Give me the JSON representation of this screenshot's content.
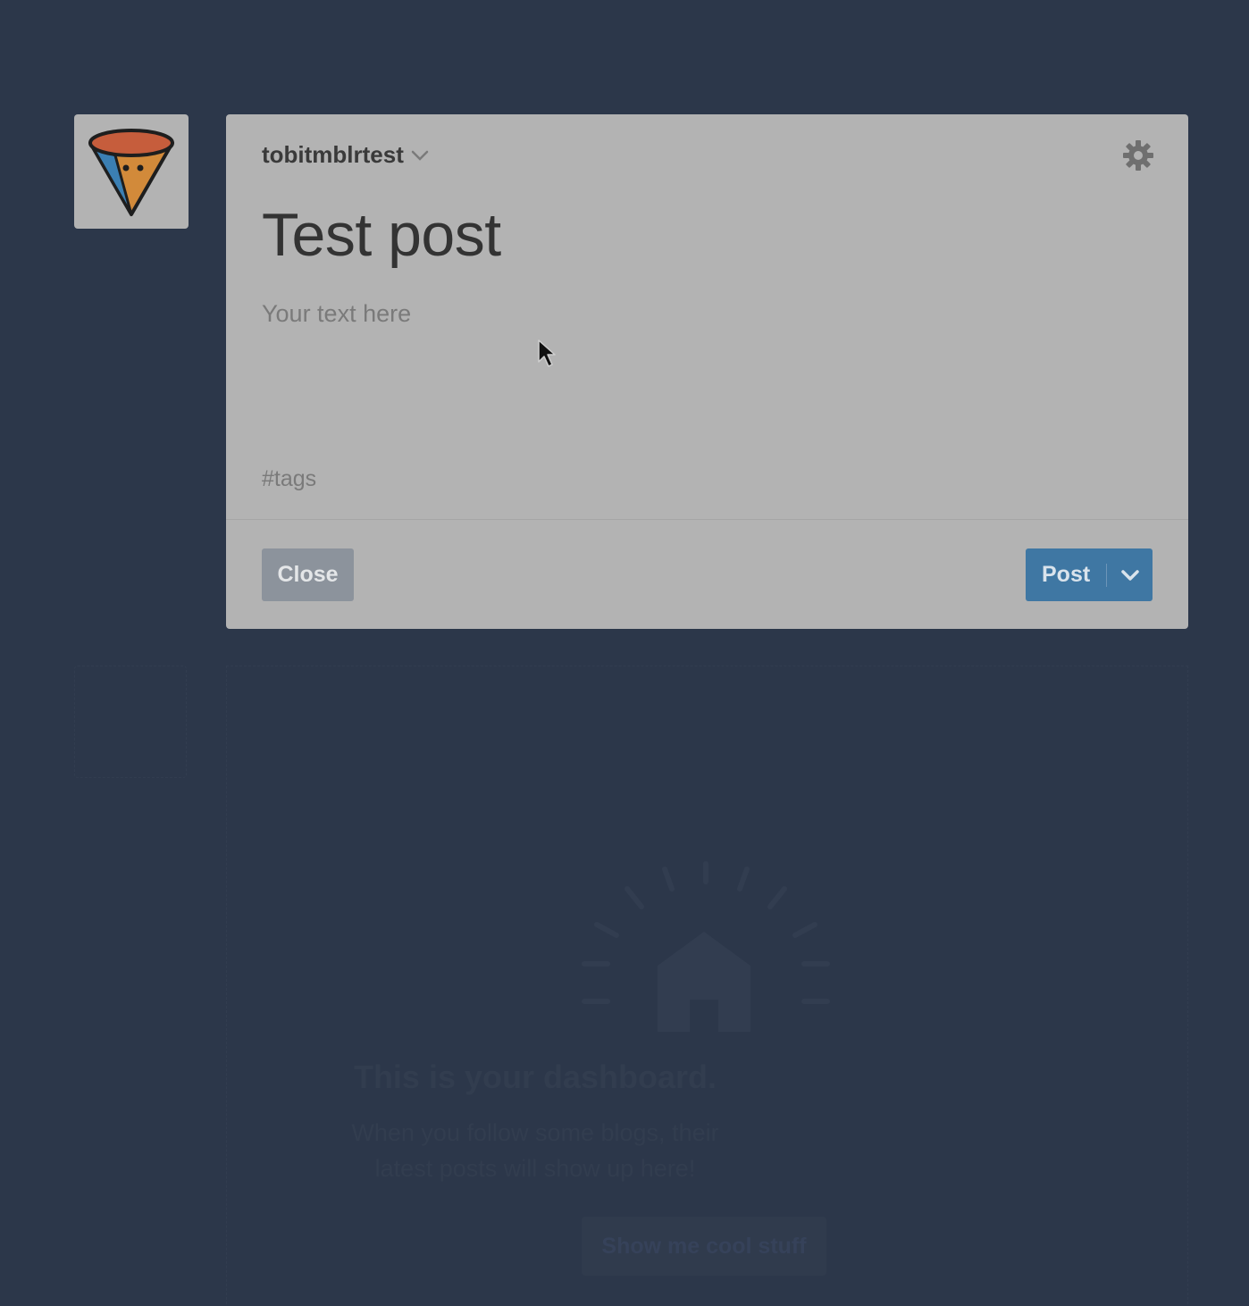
{
  "composer": {
    "blog_name": "tobitmblrtest",
    "title": "Test post",
    "body_placeholder": "Your text here",
    "tags_placeholder": "#tags",
    "close_label": "Close",
    "post_label": "Post"
  },
  "dashboard": {
    "empty_title": "This is your dashboard.",
    "empty_line1": "When you follow some blogs, their",
    "empty_line2": "latest posts will show up here!",
    "cta_label": "Show me cool stuff"
  },
  "colors": {
    "background": "#2c374a",
    "card": "#b3b3b3",
    "post_button": "#3f77a3",
    "close_button": "#8c939c"
  },
  "icons": {
    "avatar": "ice-cream-cone-face-icon",
    "settings": "gear-icon",
    "blog_dropdown": "chevron-down-icon",
    "post_dropdown": "chevron-down-icon",
    "dashboard_illustration": "house-icon"
  }
}
